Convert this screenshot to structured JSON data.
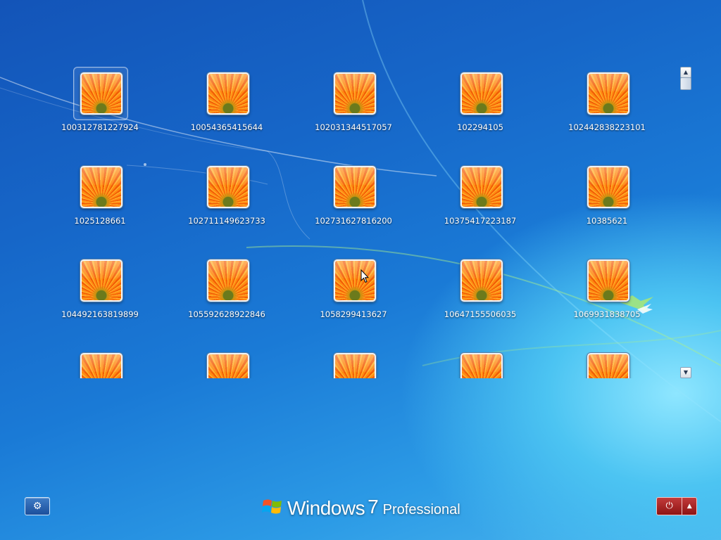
{
  "users": [
    {
      "name": "100312781227924",
      "selected": true
    },
    {
      "name": "10054365415644"
    },
    {
      "name": "102031344517057"
    },
    {
      "name": "102294105"
    },
    {
      "name": "102442838223101"
    },
    {
      "name": "1025128661"
    },
    {
      "name": "102711149623733"
    },
    {
      "name": "102731627816200"
    },
    {
      "name": "10375417223187"
    },
    {
      "name": "10385621"
    },
    {
      "name": "104492163819899"
    },
    {
      "name": "105592628922846"
    },
    {
      "name": "1058299413627"
    },
    {
      "name": "10647155506035"
    },
    {
      "name": "1069931838705"
    },
    {
      "name": ""
    },
    {
      "name": ""
    },
    {
      "name": ""
    },
    {
      "name": ""
    },
    {
      "name": ""
    }
  ],
  "user_picture_icon": "orange-flower-icon",
  "scrollbar": {
    "up_glyph": "▲",
    "down_glyph": "▼"
  },
  "ease_of_access": {
    "glyph": "⚙",
    "icon": "ease-of-access-icon"
  },
  "branding": {
    "windows": "Windows",
    "version": "7",
    "edition": "Professional"
  },
  "power": {
    "glyph": "⏻",
    "menu_glyph": "▲",
    "accent": "#a82222"
  },
  "colors": {
    "background_top": "#1354b8",
    "background_glow": "#8ee6ff",
    "label": "#ffffff"
  }
}
